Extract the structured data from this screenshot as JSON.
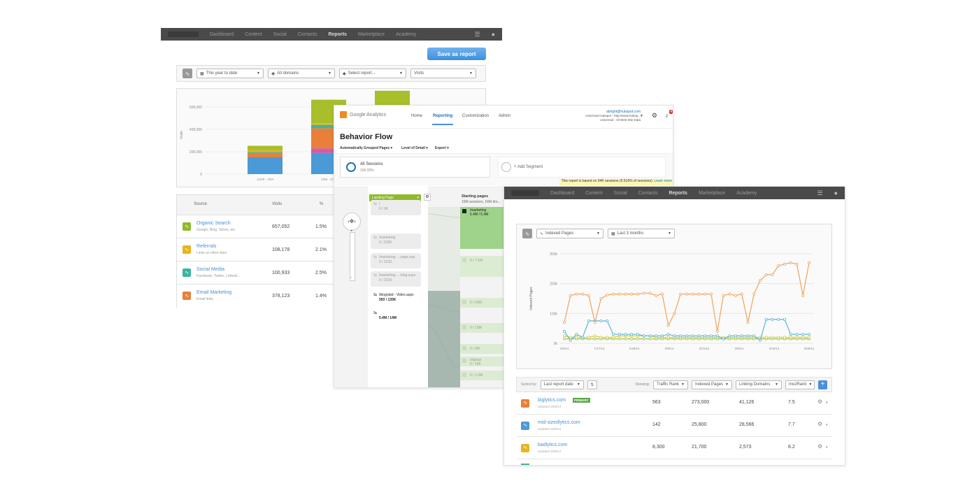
{
  "left": {
    "nav": [
      "Dashboard",
      "Content",
      "Social",
      "Contacts",
      "Reports",
      "Marketplace",
      "Academy"
    ],
    "nav_active": 4,
    "save_label": "Save as report",
    "filters": [
      "This year to date",
      "All domains",
      "Select report...",
      "Visits"
    ],
    "chart": {
      "ylabel": "Visits",
      "yticks": [
        "600,000",
        "400,000",
        "200,000",
        "0"
      ],
      "xticks": [
        "12/20 - 1/04",
        "1/05 - 1/11"
      ]
    },
    "table": {
      "headers": [
        "Source",
        "Visits",
        "%"
      ],
      "rows": [
        {
          "name": "Organic Search",
          "sub": "Google, Bing, Yahoo, etc.",
          "visits": "657,052",
          "pct": "1.5%",
          "color": "#8dbb2b"
        },
        {
          "name": "Referrals",
          "sub": "Links on other sites",
          "visits": "108,178",
          "pct": "2.1%",
          "color": "#e6b51d"
        },
        {
          "name": "Social Media",
          "sub": "Facebook, Twitter, LinkedI...",
          "visits": "100,933",
          "pct": "2.5%",
          "color": "#3bb5a0"
        },
        {
          "name": "Email Marketing",
          "sub": "Email links",
          "visits": "378,123",
          "pct": "1.4%",
          "color": "#e8803a"
        }
      ]
    }
  },
  "middle": {
    "logo": "Google Analytics",
    "nav": [
      "Home",
      "Reporting",
      "Customization",
      "Admin"
    ],
    "account_email": "abright@hubspot.com",
    "account_line2": "Universal Hubspot - http://www.hubsp...",
    "account_line3": "Universal - All Web Site Data",
    "bell_count": "4",
    "title": "Behavior Flow",
    "subnav": [
      "Automatically Grouped Pages",
      "Level of Detail",
      "Export"
    ],
    "segment_name": "All Sessions",
    "segment_pct": "100.00%",
    "add_segment": "+ Add Segment",
    "notice": "This report is based on 94K sessions (0.516% of sessions).",
    "notice_link": "Learn more",
    "landing_label": "Landing Page",
    "starting_title": "Starting pages",
    "starting_sub": "16M sessions, 16M dro...",
    "flow_items": [
      {
        "name": "/",
        "value": "0 / 0K"
      },
      {
        "name": "/marketing",
        "value": "0 / 220K"
      },
      {
        "name": "/marketing-...-page.asp",
        "value": "0 / 221K"
      },
      {
        "name": "/marketing-...-blog.aspx",
        "value": "0 / 221K"
      },
      {
        "name": "/blog/abd - Video.aspx",
        "value": "593 / 135K"
      },
      {
        "name": "",
        "value": "5.4M / 14M"
      }
    ],
    "start_items": [
      {
        "name": "/marketing",
        "value": "5.4M / 5.4M"
      },
      {
        "name": "",
        "value": "0 / 7.1M"
      },
      {
        "name": "",
        "value": "0 / 23M"
      },
      {
        "name": "",
        "value": "0 / 13M"
      },
      {
        "name": "",
        "value": "0 / 9M"
      },
      {
        "name": "/signup",
        "value": "0 / 16K"
      },
      {
        "name": "",
        "value": "0 / 1.5M"
      }
    ]
  },
  "right": {
    "nav": [
      "Dashboard",
      "Content",
      "Social",
      "Contacts",
      "Reports",
      "Marketplace",
      "Academy"
    ],
    "nav_active": 4,
    "filters": [
      "Indexed Pages",
      "Last 3 months"
    ],
    "sortbar": {
      "sorted_by_label": "Sorted by:",
      "sorted_by_value": "Last report date",
      "showing_label": "Showing:",
      "columns": [
        "Traffic Rank",
        "Indexed Pages",
        "Linking Domains",
        "mozRank"
      ]
    },
    "rows": [
      {
        "domain": "biglytics.com",
        "badge": "PRIMARY",
        "updated": "Updated 3/30/14",
        "c1": "563",
        "c2": "273,000",
        "c3": "41,126",
        "c4": "7.5",
        "color": "#e8803a"
      },
      {
        "domain": "mid-sizedlytics.com",
        "badge": "",
        "updated": "Updated 3/30/14",
        "c1": "142",
        "c2": "25,800",
        "c3": "28,566",
        "c4": "7.7",
        "color": "#4a9ad8"
      },
      {
        "domain": "badlytics.com",
        "badge": "",
        "updated": "Updated 3/30/14",
        "c1": "8,300",
        "c2": "21,700",
        "c3": "2,573",
        "c4": "6.2",
        "color": "#e6b51d"
      }
    ]
  },
  "chart_data": [
    {
      "type": "bar",
      "title": "",
      "ylabel": "Visits",
      "categories": [
        "12/20 - 1/04",
        "1/05 - 1/11",
        ""
      ],
      "ylim": [
        0,
        700000
      ],
      "series": [
        {
          "values": [
            150000,
            190000,
            270000
          ],
          "color": "#4a9ad8"
        },
        {
          "values": [
            0,
            40000,
            40000
          ],
          "color": "#d85aa3"
        },
        {
          "values": [
            40000,
            180000,
            180000
          ],
          "color": "#e8803a"
        },
        {
          "values": [
            8000,
            30000,
            30000
          ],
          "color": "#3bb5a0"
        },
        {
          "values": [
            15000,
            15000,
            15000
          ],
          "color": "#e6b51d"
        },
        {
          "values": [
            40000,
            210000,
            210000
          ],
          "color": "#a8be2a"
        }
      ]
    },
    {
      "type": "line",
      "ylabel": "Indexed Pages",
      "yticks": [
        "300k",
        "200k",
        "100k",
        "0k"
      ],
      "ylim": [
        0,
        300000
      ],
      "xticks": [
        "1/6/14",
        "1/17/14",
        "1/28/14",
        "2/8/14",
        "2/21/14",
        "3/5/14",
        "3/16/14",
        "3/28/14"
      ],
      "series": [
        {
          "color": "#f0a35a",
          "values": [
            70000,
            160000,
            165000,
            165000,
            160000,
            70000,
            150000,
            162000,
            165000,
            165000,
            165000,
            165000,
            165000,
            168000,
            168000,
            160000,
            165000,
            60000,
            100000,
            165000,
            165000,
            165000,
            165000,
            165000,
            165000,
            40000,
            160000,
            165000,
            160000,
            165000,
            70000,
            165000,
            210000,
            230000,
            230000,
            260000,
            265000,
            270000,
            265000,
            160000,
            270000
          ]
        },
        {
          "color": "#5bb5d8",
          "values": [
            40000,
            10000,
            30000,
            20000,
            75000,
            75000,
            75000,
            75000,
            30000,
            30000,
            30000,
            30000,
            30000,
            25000,
            25000,
            25000,
            25000,
            30000,
            25000,
            25000,
            25000,
            25000,
            25000,
            25000,
            25000,
            25000,
            15000,
            25000,
            25000,
            25000,
            25000,
            25000,
            10000,
            80000,
            80000,
            80000,
            80000,
            30000,
            30000,
            30000,
            30000
          ]
        },
        {
          "color": "#d8c84a",
          "values": [
            25000,
            20000,
            20000,
            20000,
            20000,
            25000,
            20000,
            20000,
            20000,
            25000,
            25000,
            25000,
            25000,
            25000,
            25000,
            20000,
            20000,
            20000,
            20000,
            20000,
            20000,
            20000,
            20000,
            20000,
            20000,
            20000,
            20000,
            20000,
            20000,
            20000,
            20000,
            20000,
            20000,
            20000,
            20000,
            20000,
            20000,
            20000,
            20000,
            20000,
            20000
          ]
        },
        {
          "color": "#9fc74a",
          "values": [
            15000,
            15000,
            15000,
            15000,
            15000,
            15000,
            15000,
            15000,
            15000,
            15000,
            15000,
            15000,
            15000,
            15000,
            15000,
            15000,
            15000,
            15000,
            15000,
            15000,
            15000,
            15000,
            15000,
            15000,
            15000,
            15000,
            15000,
            15000,
            15000,
            15000,
            15000,
            15000,
            15000,
            15000,
            15000,
            15000,
            15000,
            15000,
            15000,
            15000,
            15000
          ]
        }
      ]
    }
  ]
}
